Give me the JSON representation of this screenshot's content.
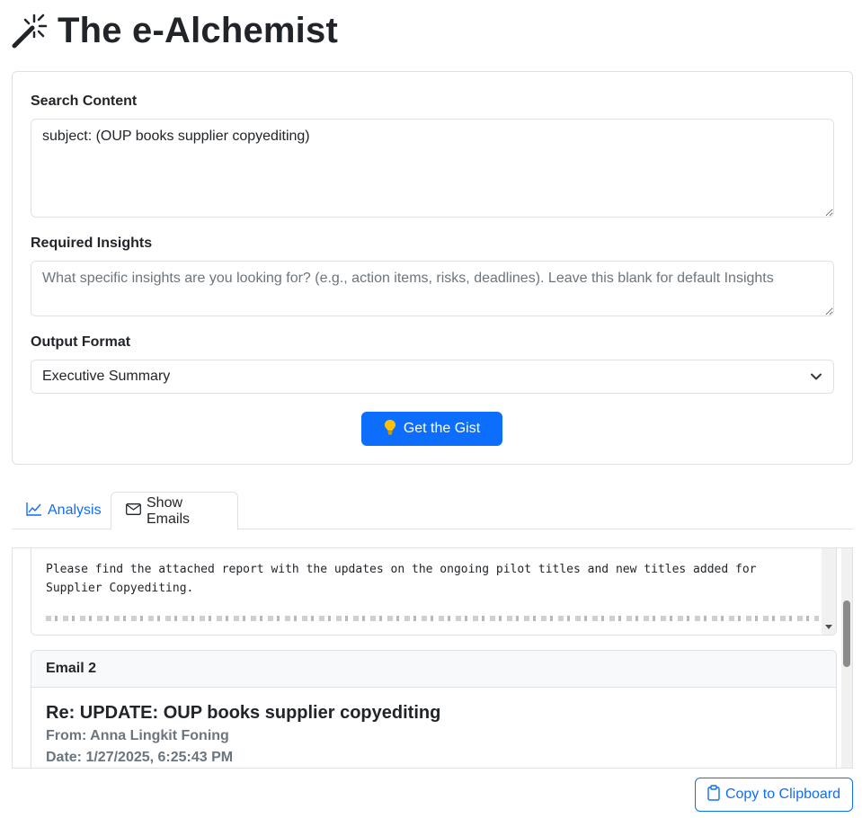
{
  "header": {
    "title": "The e-Alchemist",
    "icon": "magic-wand-icon"
  },
  "form": {
    "search_label": "Search Content",
    "search_value": "subject: (OUP books supplier copyediting)",
    "insights_label": "Required Insights",
    "insights_placeholder": "What specific insights are you looking for? (e.g., action items, risks, deadlines). Leave this blank for default Insights",
    "format_label": "Output Format",
    "format_value": "Executive Summary",
    "submit_label": "Get the Gist",
    "submit_icon": "lightbulb-icon"
  },
  "tabs": [
    {
      "label": "Analysis",
      "icon": "line-chart-icon",
      "active": false
    },
    {
      "label": "Show Emails",
      "icon": "envelope-icon",
      "active": true
    }
  ],
  "emails": {
    "email1_body": "Please find the attached report with the updates on the ongoing pilot titles and new titles added for\nSupplier Copyediting.",
    "email2": {
      "header": "Email 2",
      "subject": "Re: UPDATE: OUP books supplier copyediting",
      "from": "From: Anna Lingkit Foning",
      "date": "Date: 1/27/2025, 6:25:43 PM"
    }
  },
  "actions": {
    "copy_label": "Copy to Clipboard",
    "copy_icon": "clipboard-icon"
  },
  "colors": {
    "primary": "#0d6efd",
    "border": "#dee2e6",
    "muted": "#6c757d",
    "lightbulb": "#ffc107"
  }
}
